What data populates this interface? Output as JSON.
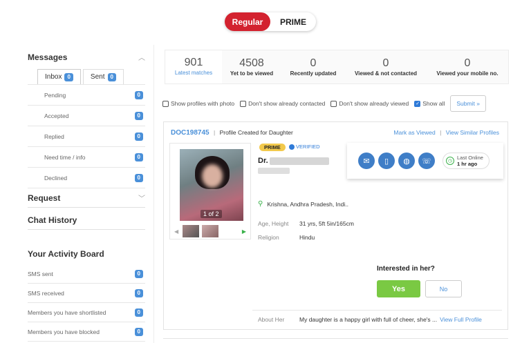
{
  "plan_toggle": {
    "regular": "Regular",
    "prime": "PRIME"
  },
  "sidebar": {
    "messages_title": "Messages",
    "tabs": [
      {
        "label": "Inbox",
        "count": "0"
      },
      {
        "label": "Sent",
        "count": "0"
      }
    ],
    "message_items": [
      {
        "label": "Pending",
        "count": "0"
      },
      {
        "label": "Accepted",
        "count": "0"
      },
      {
        "label": "Replied",
        "count": "0"
      },
      {
        "label": "Need time / info",
        "count": "0"
      },
      {
        "label": "Declined",
        "count": "0"
      }
    ],
    "request_title": "Request",
    "chat_history_title": "Chat History",
    "activity_title": "Your Activity Board",
    "activity_items": [
      {
        "label": "SMS sent",
        "count": "0"
      },
      {
        "label": "SMS received",
        "count": "0"
      },
      {
        "label": "Members you have shortlisted",
        "count": "0"
      },
      {
        "label": "Members you have blocked",
        "count": "0"
      }
    ]
  },
  "stats": [
    {
      "num": "901",
      "label": "Latest matches"
    },
    {
      "num": "4508",
      "label": "Yet to be viewed"
    },
    {
      "num": "0",
      "label": "Recently updated"
    },
    {
      "num": "0",
      "label": "Viewed & not contacted"
    },
    {
      "num": "0",
      "label": "Viewed your mobile no."
    }
  ],
  "filters": {
    "with_photo": "Show profiles with photo",
    "not_contacted": "Don't show already contacted",
    "not_viewed": "Don't show already viewed",
    "show_all": "Show all",
    "submit": "Submit »"
  },
  "profile": {
    "id": "DOC198745",
    "created_for": "Profile Created for Daughter",
    "mark_viewed": "Mark as Viewed",
    "similar": "View Similar Profiles",
    "photo_count": "1 of 2",
    "prime_badge": "PRIME",
    "verified": "VERIFIED",
    "name_prefix": "Dr.",
    "last_online_label": "Last Online",
    "last_online_value": "1 hr ago",
    "location": "Krishna, Andhra Pradesh, Indi..",
    "age_height_label": "Age, Height",
    "age_height_value": "31 yrs, 5ft 5in/165cm",
    "religion_label": "Religion",
    "religion_value": "Hindu",
    "interest_question": "Interested in her?",
    "yes": "Yes",
    "no": "No",
    "about_label": "About Her",
    "about_value": "My daughter is a happy girl with full of cheer, she's ...",
    "full_profile": "View Full Profile"
  }
}
